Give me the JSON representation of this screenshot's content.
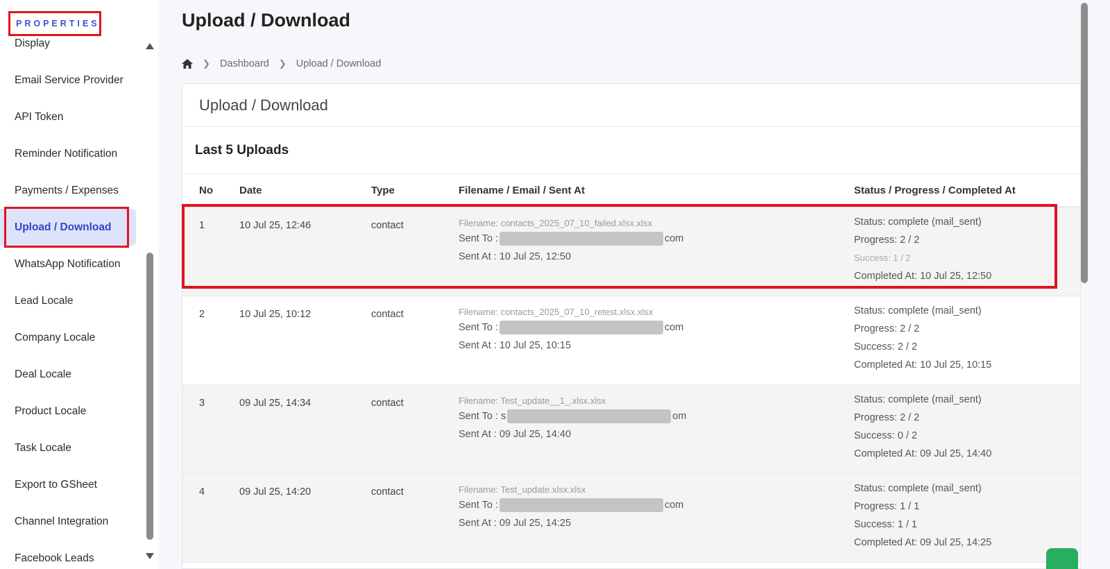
{
  "sidebar": {
    "header": "PROPERTIES",
    "items": [
      {
        "label": "Display"
      },
      {
        "label": "Email Service Provider"
      },
      {
        "label": "API Token"
      },
      {
        "label": "Reminder Notification"
      },
      {
        "label": "Payments / Expenses"
      },
      {
        "label": "Upload / Download",
        "active": true
      },
      {
        "label": "WhatsApp Notification"
      },
      {
        "label": "Lead Locale"
      },
      {
        "label": "Company Locale"
      },
      {
        "label": "Deal Locale"
      },
      {
        "label": "Product Locale"
      },
      {
        "label": "Task Locale"
      },
      {
        "label": "Export to GSheet"
      },
      {
        "label": "Channel Integration"
      },
      {
        "label": "Facebook Leads"
      }
    ]
  },
  "page": {
    "title": "Upload / Download",
    "breadcrumb": [
      "Dashboard",
      "Upload / Download"
    ]
  },
  "card": {
    "title": "Upload / Download",
    "section_title": "Last 5 Uploads",
    "columns": {
      "no": "No",
      "date": "Date",
      "type": "Type",
      "file": "Filename / Email / Sent At",
      "status": "Status / Progress / Completed At"
    },
    "rows": [
      {
        "no": "1",
        "date": "10 Jul 25, 12:46",
        "type": "contact",
        "filename": "Filename: contacts_2025_07_10_failed.xlsx.xlsx",
        "sent_to_prefix": "Sent To :",
        "sent_to_suffix": "com",
        "sent_at": "Sent At : 10 Jul 25, 12:50",
        "status": "Status: complete (mail_sent)",
        "progress": "Progress: 2 / 2",
        "success": "Success: 1 / 2",
        "completed": "Completed At: 10 Jul 25, 12:50"
      },
      {
        "no": "2",
        "date": "10 Jul 25, 10:12",
        "type": "contact",
        "filename": "Filename: contacts_2025_07_10_retest.xlsx.xlsx",
        "sent_to_prefix": "Sent To :",
        "sent_to_suffix": "com",
        "sent_at": "Sent At : 10 Jul 25, 10:15",
        "status": "Status: complete (mail_sent)",
        "progress": "Progress: 2 / 2",
        "success": "Success: 2 / 2",
        "completed": "Completed At: 10 Jul 25, 10:15"
      },
      {
        "no": "3",
        "date": "09 Jul 25, 14:34",
        "type": "contact",
        "filename": "Filename: Test_update__1_.xlsx.xlsx",
        "sent_to_prefix": "Sent To : s",
        "sent_to_suffix": "om",
        "sent_at": "Sent At : 09 Jul 25, 14:40",
        "status": "Status: complete (mail_sent)",
        "progress": "Progress: 2 / 2",
        "success": "Success: 0 / 2",
        "completed": "Completed At: 09 Jul 25, 14:40"
      },
      {
        "no": "4",
        "date": "09 Jul 25, 14:20",
        "type": "contact",
        "filename": "Filename: Test_update.xlsx.xlsx",
        "sent_to_prefix": "Sent To :",
        "sent_to_suffix": "com",
        "sent_at": "Sent At : 09 Jul 25, 14:25",
        "status": "Status: complete (mail_sent)",
        "progress": "Progress: 1 / 1",
        "success": "Success: 1 / 1",
        "completed": "Completed At: 09 Jul 25, 14:25"
      }
    ]
  },
  "icons": {
    "home": "home-icon",
    "breadcrumb_separator": "chevron-right-icon",
    "scroll_up": "scroll-up-arrow-icon",
    "scroll_down": "scroll-down-arrow-icon",
    "chat": "chat-icon"
  },
  "colors": {
    "accent": "#2f48c9",
    "active_bg": "#dde3fb",
    "highlight": "#e0141e",
    "chat": "#27ae60"
  }
}
